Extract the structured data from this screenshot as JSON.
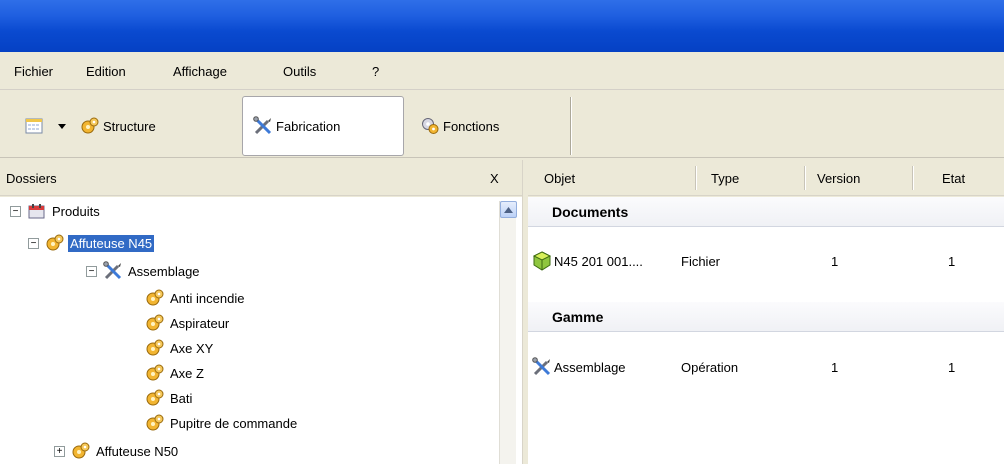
{
  "menu": [
    "Fichier",
    "Edition",
    "Affichage",
    "Outils",
    "?"
  ],
  "toolbar": {
    "structure": "Structure",
    "fabrication": "Fabrication",
    "fonctions": "Fonctions"
  },
  "left_panel": {
    "title": "Dossiers",
    "close": "X",
    "tree": [
      {
        "label": "Produits",
        "icon": "calendar-folder-icon",
        "expander": "−"
      },
      {
        "label": "Affuteuse N45",
        "icon": "gears-icon",
        "expander": "−",
        "selected": true
      },
      {
        "label": "Assemblage",
        "icon": "tools-icon",
        "expander": "−"
      },
      {
        "label": "Anti incendie",
        "icon": "gears-icon"
      },
      {
        "label": "Aspirateur",
        "icon": "gears-icon"
      },
      {
        "label": "Axe XY",
        "icon": "gears-icon"
      },
      {
        "label": "Axe Z",
        "icon": "gears-icon"
      },
      {
        "label": "Bati",
        "icon": "gears-icon"
      },
      {
        "label": "Pupitre de commande",
        "icon": "gears-icon"
      },
      {
        "label": "Affuteuse N50",
        "icon": "gears-icon",
        "expander": "+"
      }
    ]
  },
  "right_panel": {
    "columns": [
      "Objet",
      "Type",
      "Version",
      "Etat"
    ],
    "groups": [
      {
        "title": "Documents",
        "rows": [
          {
            "objet": "N45 201 001....",
            "type": "Fichier",
            "version": "1",
            "etat": "1",
            "icon": "document-cube-icon"
          }
        ]
      },
      {
        "title": "Gamme",
        "rows": [
          {
            "objet": "Assemblage",
            "type": "Opération",
            "version": "1",
            "etat": "1",
            "icon": "tools-icon"
          }
        ]
      }
    ]
  }
}
